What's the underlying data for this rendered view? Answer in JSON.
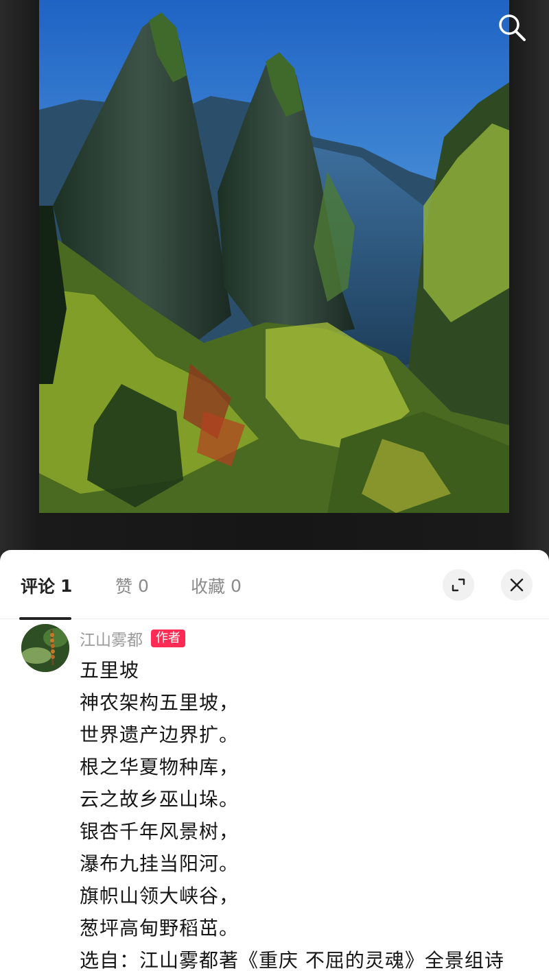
{
  "tabs": [
    {
      "label": "评论",
      "count": "1"
    },
    {
      "label": "赞",
      "count": "0"
    },
    {
      "label": "收藏",
      "count": "0"
    }
  ],
  "comment": {
    "author": "江山雾都",
    "badge": "作者",
    "lines": [
      "五里坡",
      "神农架构五里坡，",
      "世界遗产边界扩。",
      "根之华夏物种库，",
      "云之故乡巫山垛。",
      "银杏千年风景树，",
      "瀑布九挂当阳河。",
      "旗帜山领大峡谷，",
      "葱坪高甸野稻茁。",
      "选自：江山雾都著《重庆  不屈的灵魂》全景组诗"
    ]
  },
  "icons": {
    "search": "search-icon",
    "expand": "expand-icon",
    "close": "close-icon"
  },
  "colors": {
    "badge": "#fe2c55",
    "active_tab": "#222222",
    "inactive_tab": "#8a8a8a"
  }
}
